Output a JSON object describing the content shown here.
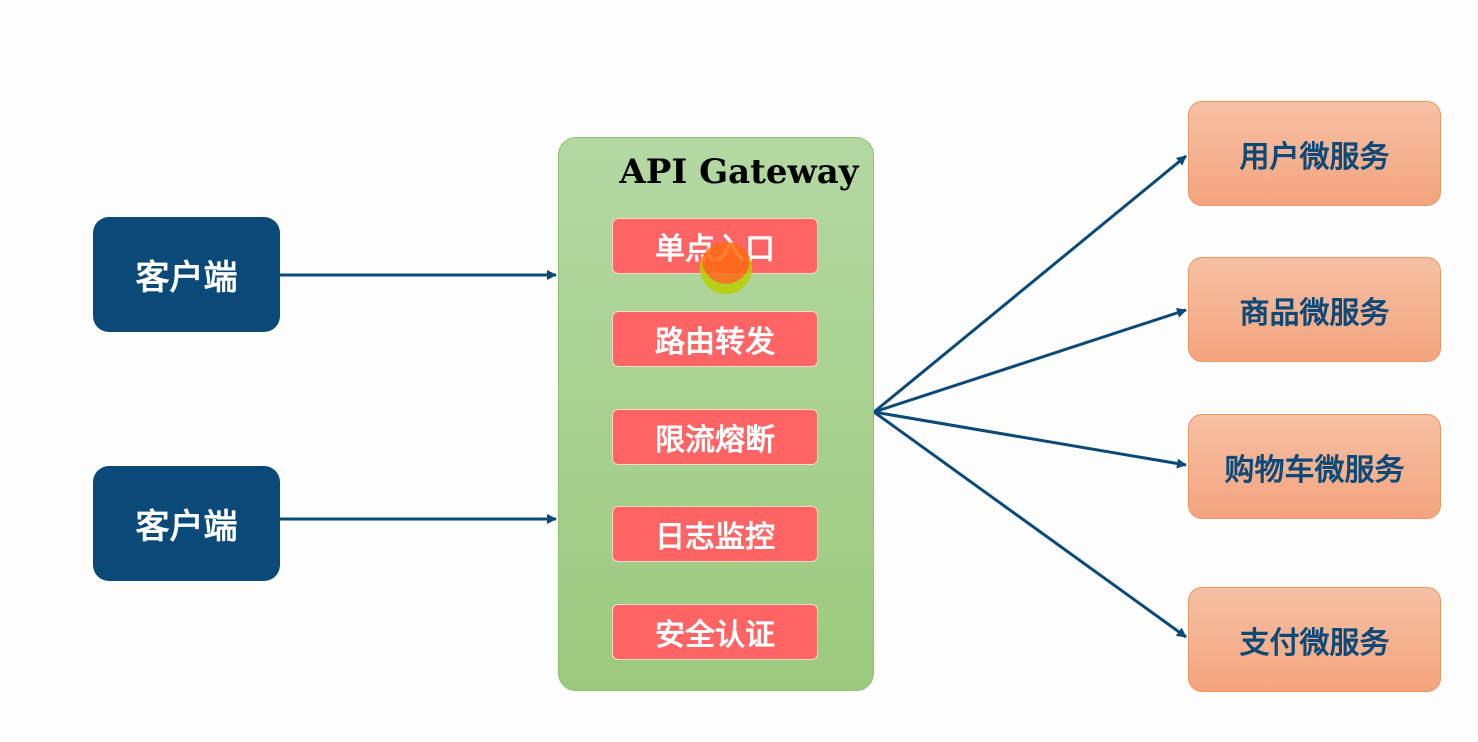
{
  "clients": [
    {
      "label": "客户端"
    },
    {
      "label": "客户端"
    }
  ],
  "gateway": {
    "title": "API Gateway",
    "features": [
      {
        "label": "单点入口"
      },
      {
        "label": "路由转发"
      },
      {
        "label": "限流熔断"
      },
      {
        "label": "日志监控"
      },
      {
        "label": "安全认证"
      }
    ]
  },
  "services": [
    {
      "label": "用户微服务"
    },
    {
      "label": "商品微服务"
    },
    {
      "label": "购物车微服务"
    },
    {
      "label": "支付微服务"
    }
  ],
  "colors": {
    "client": "#0b4a78",
    "gateway": "#a8d194",
    "feature": "#ff6464",
    "service": "#f5b091",
    "arrow": "#0b4a78"
  }
}
